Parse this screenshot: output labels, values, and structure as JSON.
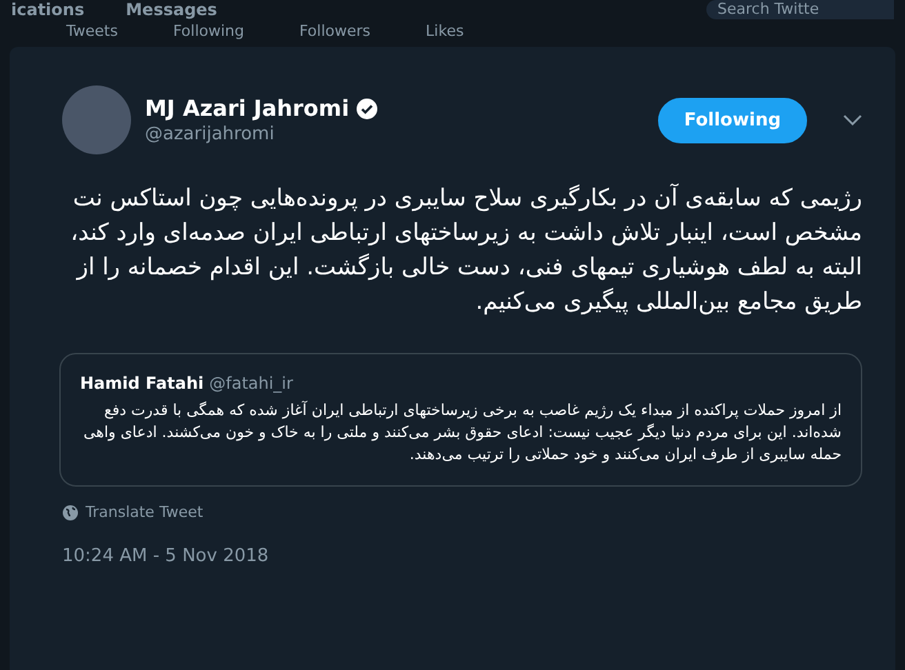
{
  "nav": {
    "link_1": "ications",
    "link_2": "Messages",
    "search": {
      "placeholder": "Search Twitte"
    }
  },
  "profile_stats": {
    "tweets": "Tweets",
    "following": "Following",
    "followers": "Followers",
    "likes": "Likes"
  },
  "tweet": {
    "author": {
      "name": "MJ Azari Jahromi",
      "handle": "@azarijahromi",
      "verified": true
    },
    "follow_button": {
      "label": "Following",
      "selected": true
    },
    "text": "رژیمی که سابقه‌ی آن در بکارگیری سلاح سایبری در پرونده‌هایی چون استاکس نت مشخص است، اینبار تلاش داشت به زیرساختهای ارتباطی ایران صدمه‌ای وارد کند، البته به لطف هوشیاری تیمهای فنی، دست خالی بازگشت. این اقدام خصمانه را از طریق مجامع بین‌المللی پیگیری می‌کنیم.",
    "quoted": {
      "name": "Hamid Fatahi",
      "handle": "@fatahi_ir",
      "text": "از امروز حملات پراکنده از مبداء یک رژیم غاصب به برخی زیرساختهای ارتباطی ایران آغاز شده که همگی با قدرت دفع شده‌اند. این برای مردم دنیا دیگر عجیب نیست: ادعای حقوق بشر می‌کنند و ملتی را به خاک و خون می‌کشند. ادعای واهی حمله سایبری از طرف ایران می‌کنند و خود حملاتی را ترتیب می‌دهند."
    },
    "translate": "Translate Tweet",
    "timestamp": "10:24 AM - 5 Nov 2018"
  }
}
